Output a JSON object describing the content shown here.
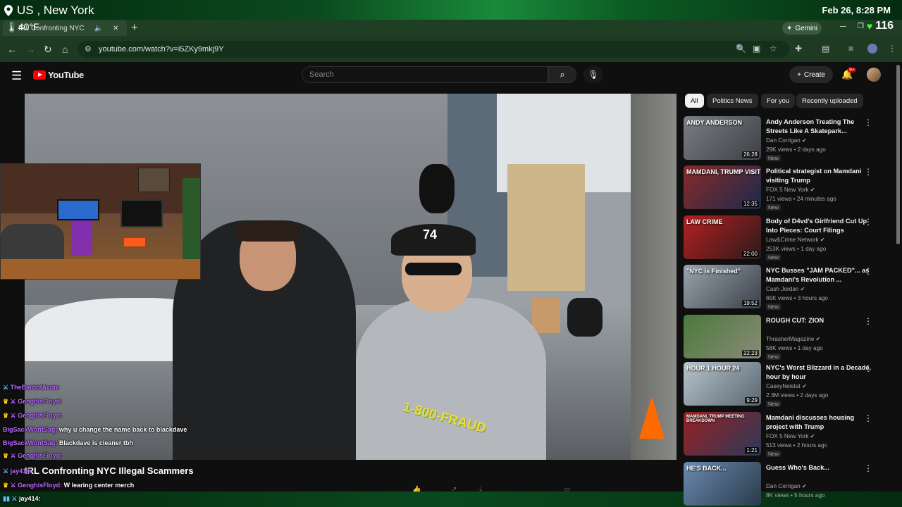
{
  "overlay": {
    "location": "US , New York",
    "temperature": "40°F",
    "datetime": "Feb 26, 8:28 PM",
    "hearts": "116"
  },
  "browser": {
    "tab_title": "IRL Confronting NYC",
    "gemini_label": "Gemini",
    "url": "youtube.com/watch?v=i5ZKy9mkj9Y"
  },
  "youtube": {
    "logo": "YouTube",
    "search_placeholder": "Search",
    "create_label": "Create",
    "notif_count": "9+",
    "video_title": "IRL Confronting NYC Illegal Scammers",
    "video_sign": "1-800-FRAUD",
    "hat_number": "74",
    "chips": [
      "All",
      "Politics News",
      "For you",
      "Recently uploaded"
    ]
  },
  "chat": [
    {
      "name": "TheBardofAvon:",
      "msg": ""
    },
    {
      "name": "GenghisFloyd:",
      "msg": ""
    },
    {
      "name": "GenghisFloyd:",
      "msg": ""
    },
    {
      "name": "BigSackWontSag:",
      "msg": "why u change the name back to blackdave"
    },
    {
      "name": "BigSackWontSag:",
      "msg": "Blackdave is cleaner tbh"
    },
    {
      "name": "GenghisFloyd:",
      "msg": ""
    },
    {
      "name": "jay414:",
      "msg": ""
    },
    {
      "name": "GenghisFloyd:",
      "msg": "W learing center merch"
    },
    {
      "name": "jay414:",
      "msg": ""
    }
  ],
  "recommendations": [
    {
      "title": "Andy Anderson Treating The Streets Like A Skatepark...",
      "channel": "Dan Corrigan",
      "meta": "29K views • 2 days ago",
      "badge": "New",
      "duration": "26:28",
      "thumb_text": "ANDY ANDERSON",
      "color1": "#7a7f85",
      "color2": "#3d3f42"
    },
    {
      "title": "Political strategist on Mamdani visiting Trump",
      "channel": "FOX 5 New York",
      "meta": "171 views • 24 minutes ago",
      "badge": "New",
      "duration": "12:35",
      "thumb_text": "MAMDANI, TRUMP VISIT",
      "color1": "#8a2a2a",
      "color2": "#1a2a4a"
    },
    {
      "title": "Body of D4vd's Girlfriend Cut Up Into Pieces: Court Filings",
      "channel": "Law&Crime Network",
      "meta": "253K views • 1 day ago",
      "badge": "New",
      "duration": "22:00",
      "thumb_text": "LAW CRIME",
      "color1": "#b82020",
      "color2": "#2a1a1a"
    },
    {
      "title": "NYC Busses \"JAM PACKED\"... as Mamdani's Revolution ...",
      "channel": "Cash Jordan",
      "meta": "65K views • 3 hours ago",
      "badge": "New",
      "duration": "19:52",
      "thumb_text": "\"NYC is Finished\"",
      "color1": "#9aa4ae",
      "color2": "#3a4048"
    },
    {
      "title": "ROUGH CUT: ZION",
      "channel": "ThrasherMagazine",
      "meta": "58K views • 1 day ago",
      "badge": "New",
      "duration": "22:23",
      "thumb_text": "",
      "color1": "#4a7a3a",
      "color2": "#8a8a7a"
    },
    {
      "title": "NYC's Worst Blizzard in a Decade, hour by hour",
      "channel": "CaseyNeistat",
      "meta": "2.3M views • 2 days ago",
      "badge": "New",
      "duration": "9:29",
      "thumb_text": "HOUR 1   HOUR 24",
      "color1": "#b8c4cc",
      "color2": "#5a6670"
    },
    {
      "title": "Mamdani discusses housing project with Trump",
      "channel": "FOX 5 New York",
      "meta": "513 views • 2 hours ago",
      "badge": "New",
      "duration": "1:21",
      "thumb_text": "MAMDANI, TRUMP MEETING BREAKDOWN",
      "color1": "#9a2020",
      "color2": "#2a3a5a"
    },
    {
      "title": "Guess Who's Back...",
      "channel": "Dan Corrigan",
      "meta": "8K views • 5 hours ago",
      "badge": "",
      "duration": "",
      "thumb_text": "HE'S BACK...",
      "color1": "#6a8ab0",
      "color2": "#2a3a4a"
    }
  ]
}
